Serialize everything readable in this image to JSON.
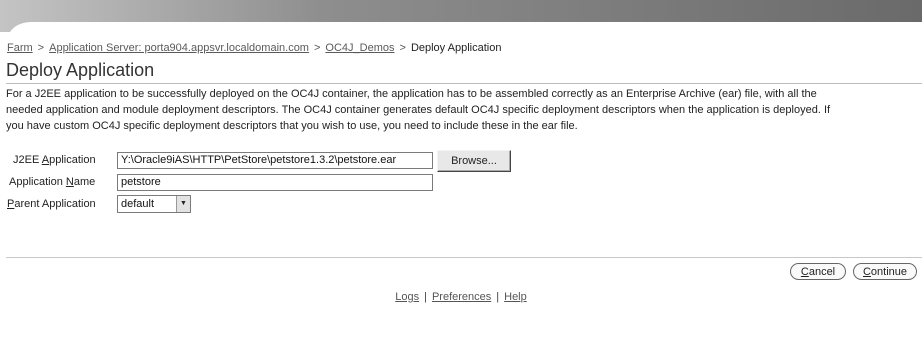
{
  "breadcrumb": {
    "items": [
      {
        "label": "Farm"
      },
      {
        "label": "Application Server: porta904.appsvr.localdomain.com"
      },
      {
        "label": "OC4J_Demos"
      }
    ],
    "separator": ">",
    "current": "Deploy Application"
  },
  "page": {
    "title": "Deploy Application",
    "description_lines": [
      "For a J2EE application to be successfully deployed on the OC4J container, the application has to be assembled correctly as an Enterprise Archive (ear) file, with all the",
      "needed application and module deployment descriptors. The OC4J container generates default OC4J specific deployment descriptors when the application is deployed. If",
      "you have custom OC4J specific deployment descriptors that you wish to use, you need to include these in the ear file."
    ]
  },
  "form": {
    "j2ee_application": {
      "label_before": "J2EE ",
      "label_access": "A",
      "label_after": "pplication",
      "value": "Y:\\Oracle9iAS\\HTTP\\PetStore\\petstore1.3.2\\petstore.ear",
      "browse_label": "Browse..."
    },
    "application_name": {
      "label_before": "Application ",
      "label_access": "N",
      "label_after": "ame",
      "value": "petstore"
    },
    "parent_application": {
      "label_before": "",
      "label_access": "P",
      "label_after": "arent Application",
      "selected": "default"
    }
  },
  "actions": {
    "cancel_access": "C",
    "cancel_rest": "ancel",
    "continue_access": "C",
    "continue_rest": "ontinue"
  },
  "footer": {
    "links": [
      {
        "label": "Logs"
      },
      {
        "label": "Preferences"
      },
      {
        "label": "Help"
      }
    ],
    "separator": "|"
  },
  "colors": {
    "banner_gradient_start": "#b0b0b0",
    "banner_gradient_end": "#6d6d6d"
  }
}
